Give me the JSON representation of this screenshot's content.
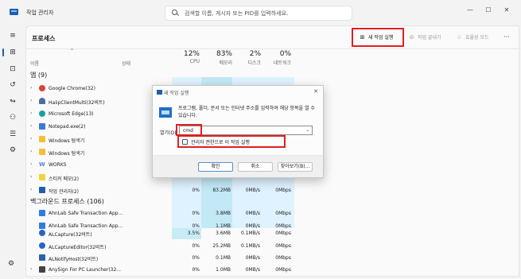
{
  "app": {
    "title": "작업 관리자"
  },
  "search": {
    "placeholder": "검색할 이름, 게시자 또는 PID를 입력하세요."
  },
  "window_controls": {
    "minimize": "—",
    "maximize": "☐",
    "close": "✕"
  },
  "page": {
    "title": "프로세스"
  },
  "toolbar": {
    "new_task": "새 작업 실행",
    "end_task": "작업 끝내기",
    "efficiency": "효율성 모드",
    "more": "···"
  },
  "columns": {
    "name": "이름",
    "status": "상태",
    "cpu": {
      "pct": "12%",
      "label": "CPU"
    },
    "memory": {
      "pct": "83%",
      "label": "메모리"
    },
    "disk": {
      "pct": "2%",
      "label": "디스크"
    },
    "network": {
      "pct": "0%",
      "label": "네트워크"
    }
  },
  "apps_group": {
    "label": "앱 (9)"
  },
  "apps": [
    {
      "name": "Google Chrome(32)",
      "icon": "chrome-icon",
      "color": "#db4437"
    },
    {
      "name": "HaiipClientMulti(32비트)",
      "icon": "person-icon",
      "color": "#4a6ea8"
    },
    {
      "name": "Microsoft Edge(13)",
      "icon": "edge-icon",
      "color": "#1aa0a0"
    },
    {
      "name": "Notepad.exe(2)",
      "icon": "notepad-icon",
      "color": "#3a7bd5"
    },
    {
      "name": "Windows 탐색기",
      "icon": "folder-icon",
      "color": "#f2c037"
    },
    {
      "name": "Windows 탐색기",
      "icon": "folder-icon",
      "color": "#f2c037"
    },
    {
      "name": "WORKS",
      "icon": "works-icon",
      "color": "#5b7dd8"
    },
    {
      "name": "스티커 메모(2)",
      "icon": "sticky-note-icon",
      "color": "#f3d33a"
    },
    {
      "name": "작업 관리자(2)",
      "icon": "taskmgr-icon",
      "color": "#1f5fae",
      "cpu": "0%",
      "memory": "83.2MB",
      "disk": "0MB/s",
      "network": "0Mbps"
    }
  ],
  "background_group": {
    "label": "백그라운드 프로세스 (106)"
  },
  "background": [
    {
      "name": "AhnLab Safe Transaction App...",
      "color": "#2f7de1",
      "cpu": "0%",
      "memory": "3.8MB",
      "disk": "0MB/s",
      "network": "0Mbps"
    },
    {
      "name": "AhnLab Safe Transaction App...",
      "color": "#2f7de1",
      "cpu": "0%",
      "memory": "1.1MB",
      "disk": "0MB/s",
      "network": "0Mbps"
    },
    {
      "name": "ALCapture(32비트)",
      "color": "#2a62c9",
      "cpu": "3.5%",
      "memory": "3.6MB",
      "disk": "0.1MB/s",
      "network": "0Mbps"
    },
    {
      "name": "ALCaptureEditor(32비트)",
      "color": "#2a62c9",
      "cpu": "0%",
      "memory": "25.2MB",
      "disk": "0.1MB/s",
      "network": "0Mbps"
    },
    {
      "name": "ALNotifyHost(32비트)",
      "color": "#2f5fa8",
      "cpu": "0%",
      "memory": "0.1MB",
      "disk": "0MB/s",
      "network": "0Mbps"
    },
    {
      "name": "AnySign For PC Launcher(32...",
      "color": "#444",
      "cpu": "0%",
      "memory": "1.0MB",
      "disk": "0MB/s",
      "network": "0Mbps"
    }
  ],
  "dialog": {
    "title": "새 작업 실행",
    "close": "✕",
    "description": "프로그램, 폴더, 문서 또는 인터넷 주소를 입력하여 해당 항목을 열 수 있습니다.",
    "open_label": "열기(O):",
    "input_value": "cmd",
    "checkbox_label": "관리자 권한으로 이 작업 실행",
    "ok": "확인",
    "cancel": "취소",
    "browse": "찾아보기(B)..."
  }
}
